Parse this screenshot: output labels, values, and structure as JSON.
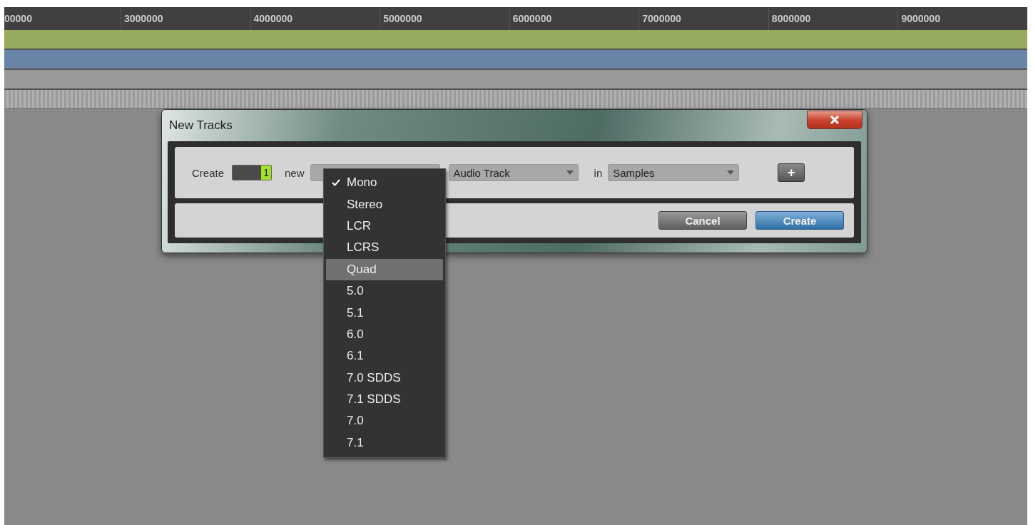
{
  "ruler": {
    "labels": [
      "00000",
      "3000000",
      "4000000",
      "5000000",
      "6000000",
      "7000000",
      "8000000",
      "9000000"
    ]
  },
  "tracks": [
    {
      "color": "#97ab5e"
    },
    {
      "color": "#6884a6"
    },
    {
      "color": "#999999"
    }
  ],
  "dialog": {
    "title": "New Tracks",
    "create_label": "Create",
    "count": "1",
    "new_label": "new",
    "track_type": "Audio Track",
    "in_label": "in",
    "timebase": "Samples",
    "add_button": "+",
    "buttons": [
      {
        "label": "Cancel",
        "kind": "secondary"
      },
      {
        "label": "Create",
        "kind": "primary"
      }
    ]
  },
  "format_menu": {
    "items": [
      {
        "label": "Mono",
        "checked": true,
        "highlighted": false
      },
      {
        "label": "Stereo",
        "checked": false,
        "highlighted": false
      },
      {
        "label": "LCR",
        "checked": false,
        "highlighted": false
      },
      {
        "label": "LCRS",
        "checked": false,
        "highlighted": false
      },
      {
        "label": "Quad",
        "checked": false,
        "highlighted": true
      },
      {
        "label": "5.0",
        "checked": false,
        "highlighted": false
      },
      {
        "label": "5.1",
        "checked": false,
        "highlighted": false
      },
      {
        "label": "6.0",
        "checked": false,
        "highlighted": false
      },
      {
        "label": "6.1",
        "checked": false,
        "highlighted": false
      },
      {
        "label": "7.0 SDDS",
        "checked": false,
        "highlighted": false
      },
      {
        "label": "7.1 SDDS",
        "checked": false,
        "highlighted": false
      },
      {
        "label": "7.0",
        "checked": false,
        "highlighted": false
      },
      {
        "label": "7.1",
        "checked": false,
        "highlighted": false
      }
    ]
  }
}
